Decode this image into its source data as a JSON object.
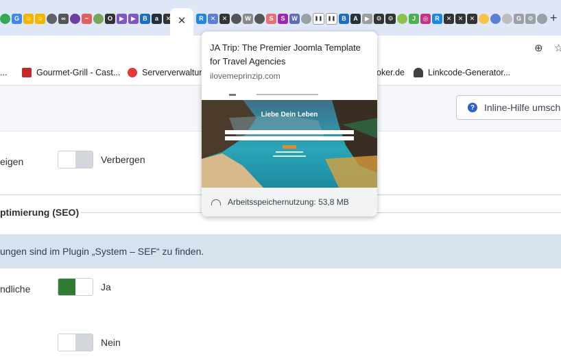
{
  "tabs": {
    "favicons": [
      {
        "name": "drive-icon",
        "bg": "#34a853",
        "t": ""
      },
      {
        "name": "google-icon",
        "bg": "#4285f4",
        "t": "G"
      },
      {
        "name": "smiley-icon",
        "bg": "#f4b400",
        "t": "☺"
      },
      {
        "name": "smiley-icon",
        "bg": "#f4b400",
        "t": "☺"
      },
      {
        "name": "globe-icon",
        "bg": "#5f6368",
        "t": ""
      },
      {
        "name": "link-icon",
        "bg": "#555555",
        "t": "∞"
      },
      {
        "name": "inbox-icon",
        "bg": "#6b3fa0",
        "t": ""
      },
      {
        "name": "audio-icon",
        "bg": "#e06060",
        "t": "~"
      },
      {
        "name": "page-icon",
        "bg": "#78a55a",
        "t": ""
      },
      {
        "name": "circle-icon",
        "bg": "#333333",
        "t": "O"
      },
      {
        "name": "play-icon",
        "bg": "#7e57c2",
        "t": "▶"
      },
      {
        "name": "play-icon",
        "bg": "#7e57c2",
        "t": "▶"
      },
      {
        "name": "bod-icon",
        "bg": "#1b6ec2",
        "t": "B"
      },
      {
        "name": "amazon-icon",
        "bg": "#232f3e",
        "t": "a"
      },
      {
        "name": "joomla-icon",
        "bg": "#333333",
        "t": "✕"
      }
    ],
    "favicons_right": [
      {
        "name": "rs-icon",
        "bg": "#1e88e5",
        "t": "R"
      },
      {
        "name": "joomla-icon",
        "bg": "#5b7fd6",
        "t": "✕"
      },
      {
        "name": "joomla-icon",
        "bg": "#333333",
        "t": "✕"
      },
      {
        "name": "globe-icon",
        "bg": "#555555",
        "t": ""
      },
      {
        "name": "wp-icon",
        "bg": "#888888",
        "t": "W"
      },
      {
        "name": "globe-icon",
        "bg": "#555555",
        "t": ""
      },
      {
        "name": "swirl-icon",
        "bg": "#e57373",
        "t": "S"
      },
      {
        "name": "swirl-icon",
        "bg": "#9c27b0",
        "t": "S"
      },
      {
        "name": "w-icon",
        "bg": "#5c6bc0",
        "t": "W"
      },
      {
        "name": "globe-icon",
        "bg": "#9aa0a6",
        "t": ""
      },
      {
        "name": "pause-icon",
        "bg": "#ffffff",
        "t": "❚❚"
      },
      {
        "name": "pause-icon",
        "bg": "#ffffff",
        "t": "❚❚"
      },
      {
        "name": "bod-icon",
        "bg": "#1b6ec2",
        "t": "B"
      },
      {
        "name": "a-icon",
        "bg": "#263238",
        "t": "A"
      },
      {
        "name": "play-icon",
        "bg": "#9e9e9e",
        "t": "▶"
      },
      {
        "name": "gear-icon",
        "bg": "#333333",
        "t": "⚙"
      },
      {
        "name": "gear-icon",
        "bg": "#333333",
        "t": "⚙"
      },
      {
        "name": "leaf-icon",
        "bg": "#8bc34a",
        "t": ""
      },
      {
        "name": "jg-icon",
        "bg": "#4caf50",
        "t": "J"
      },
      {
        "name": "instagram-icon",
        "bg": "#c13584",
        "t": "◎"
      },
      {
        "name": "rs-icon",
        "bg": "#1e88e5",
        "t": "R"
      },
      {
        "name": "joomla-icon",
        "bg": "#333333",
        "t": "✕"
      },
      {
        "name": "joomla-icon",
        "bg": "#333333",
        "t": "✕"
      },
      {
        "name": "joomla-icon",
        "bg": "#333333",
        "t": "✕"
      },
      {
        "name": "folder-icon",
        "bg": "#f6c343",
        "t": ""
      },
      {
        "name": "calendar-icon",
        "bg": "#5b7fd6",
        "t": ""
      },
      {
        "name": "image-icon",
        "bg": "#bdbdbd",
        "t": ""
      },
      {
        "name": "google-icon",
        "bg": "#9aa0a6",
        "t": "G"
      },
      {
        "name": "gear-icon",
        "bg": "#9aa0a6",
        "t": "⚙"
      },
      {
        "name": "page-icon",
        "bg": "#9aa0a6",
        "t": ""
      }
    ],
    "close_symbol": "✕",
    "newtab_symbol": "+"
  },
  "toolbar": {
    "zoom_symbol": "⊕",
    "star_symbol": "☆"
  },
  "bookmarks": {
    "items": [
      {
        "label": "..."
      },
      {
        "label": "Gourmet-Grill - Cast..."
      },
      {
        "label": "Serververwaltung"
      },
      {
        "label": "oker.de"
      },
      {
        "label": "Linkcode-Generator..."
      }
    ]
  },
  "admin": {
    "help_label": "Inline-Hilfe umsch",
    "help_symbol": "?",
    "row1_label": "eigen",
    "row1_value": "Verbergen",
    "section_title": "ptimierung (SEO)",
    "info_text": "ungen sind im Plugin „System – SEF“ zu finden.",
    "row2_label": "ndliche",
    "row2_value": "Ja",
    "row3_value": "Nein"
  },
  "hovercard": {
    "title": "JA Trip: The Premier Joomla Template for Travel Agencies",
    "domain": "ilovemeprinzip.com",
    "preview_heading": "Liebe Dein Leben",
    "memory": "Arbeitsspeichernutzung: 53,8 MB"
  },
  "colors": {
    "tabstrip": "#dfe7f7",
    "toggle_on": "#2e7d32",
    "toggle_off": "#d3d6da",
    "info_bar": "#d8e1ee",
    "help_icon": "#2a62c9"
  }
}
